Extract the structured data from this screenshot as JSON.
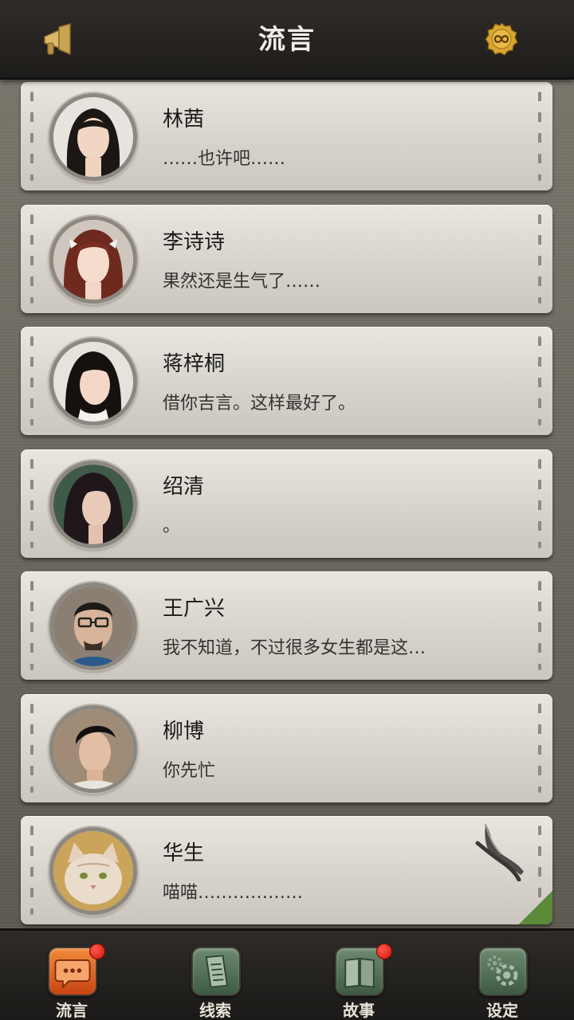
{
  "header": {
    "title": "流言",
    "left_icon": "megaphone-icon",
    "right_icon": "infinity-coin-icon"
  },
  "messages": [
    {
      "name": "林茜",
      "preview": "……也许吧……"
    },
    {
      "name": "李诗诗",
      "preview": "果然还是生气了……"
    },
    {
      "name": "蒋梓桐",
      "preview": "借你吉言。这样最好了。"
    },
    {
      "name": "绍清",
      "preview": "。"
    },
    {
      "name": "王广兴",
      "preview": "我不知道，不过很多女生都是这…"
    },
    {
      "name": "柳博",
      "preview": "你先忙"
    },
    {
      "name": "华生",
      "preview": "喵喵………………"
    }
  ],
  "tabs": [
    {
      "label": "流言",
      "active": true,
      "badge": true,
      "icon": "chat-bubble-icon"
    },
    {
      "label": "线索",
      "active": false,
      "badge": false,
      "icon": "document-icon"
    },
    {
      "label": "故事",
      "active": false,
      "badge": true,
      "icon": "book-icon"
    },
    {
      "label": "设定",
      "active": false,
      "badge": false,
      "icon": "gear-icon"
    }
  ],
  "colors": {
    "header_bg": "#26231f",
    "card_bg": "#dedad2",
    "active_tab": "#e0621f",
    "inactive_tab": "#567259",
    "badge": "#e0160d"
  }
}
